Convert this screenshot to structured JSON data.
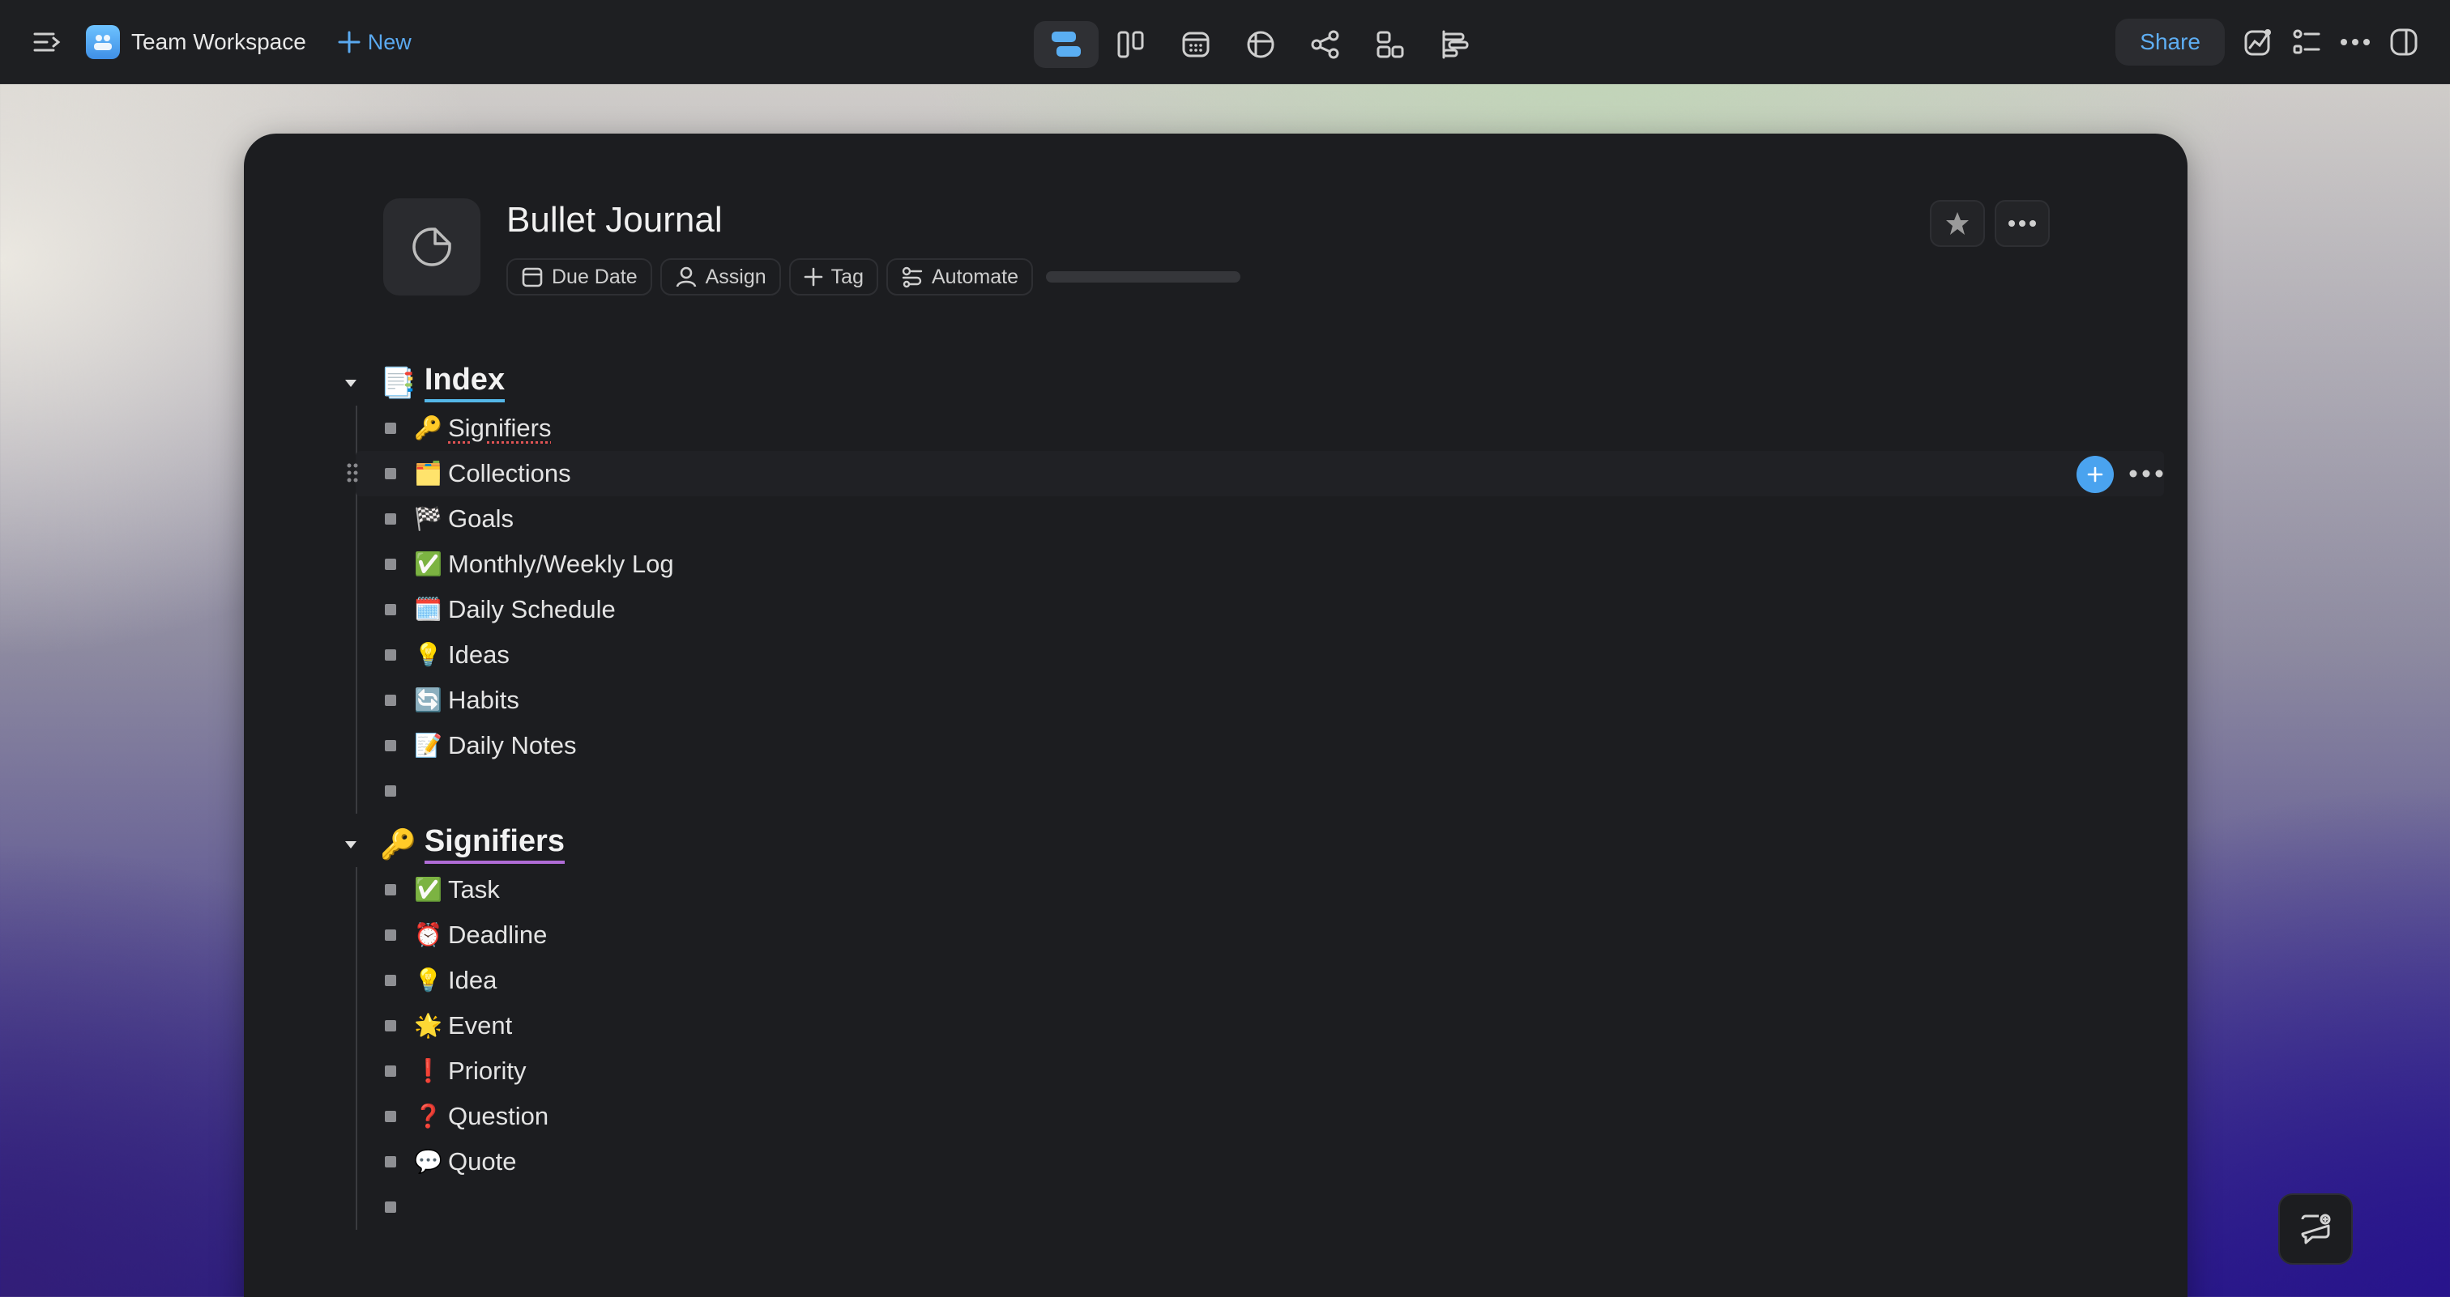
{
  "topbar": {
    "workspace_name": "Team Workspace",
    "new_label": "New",
    "share_label": "Share",
    "views": [
      "outline-view-icon",
      "board-view-icon",
      "calendar-view-icon",
      "table-view-icon",
      "mindmap-view-icon",
      "hierarchy-view-icon",
      "gantt-view-icon"
    ],
    "active_view": "outline-view-icon"
  },
  "document": {
    "title": "Bullet Journal",
    "properties": {
      "due_date": "Due Date",
      "assign": "Assign",
      "tag": "Tag",
      "automate": "Automate"
    },
    "progress": 0
  },
  "outline": {
    "sections": [
      {
        "emoji": "📑",
        "title": "Index",
        "underline": "#54b7e8",
        "items": [
          {
            "emoji": "🔑",
            "text": "Signifiers",
            "spell": true
          },
          {
            "emoji": "🗂️",
            "text": "Collections",
            "hover": true
          },
          {
            "emoji": "🏁",
            "text": "Goals"
          },
          {
            "emoji": "✅",
            "text": "Monthly/Weekly Log"
          },
          {
            "emoji": "🗓️",
            "text": "Daily Schedule"
          },
          {
            "emoji": "💡",
            "text": "Ideas"
          },
          {
            "emoji": "🔄",
            "text": "Habits"
          },
          {
            "emoji": "📝",
            "text": "Daily Notes"
          },
          {
            "emoji": "",
            "text": ""
          }
        ]
      },
      {
        "emoji": "🔑",
        "title": "Signifiers",
        "underline": "#b06cd6",
        "items": [
          {
            "emoji": "✅",
            "text": "Task"
          },
          {
            "emoji": "⏰",
            "text": "Deadline"
          },
          {
            "emoji": "💡",
            "text": "Idea"
          },
          {
            "emoji": "🌟",
            "text": "Event"
          },
          {
            "emoji": "❗",
            "text": "Priority"
          },
          {
            "emoji": "❓",
            "text": "Question"
          },
          {
            "emoji": "💬",
            "text": "Quote"
          },
          {
            "emoji": "",
            "text": ""
          }
        ]
      }
    ]
  },
  "colors": {
    "accent": "#4aa3ef",
    "topbar_bg": "#1e1f22",
    "card_bg": "#1c1d20"
  }
}
